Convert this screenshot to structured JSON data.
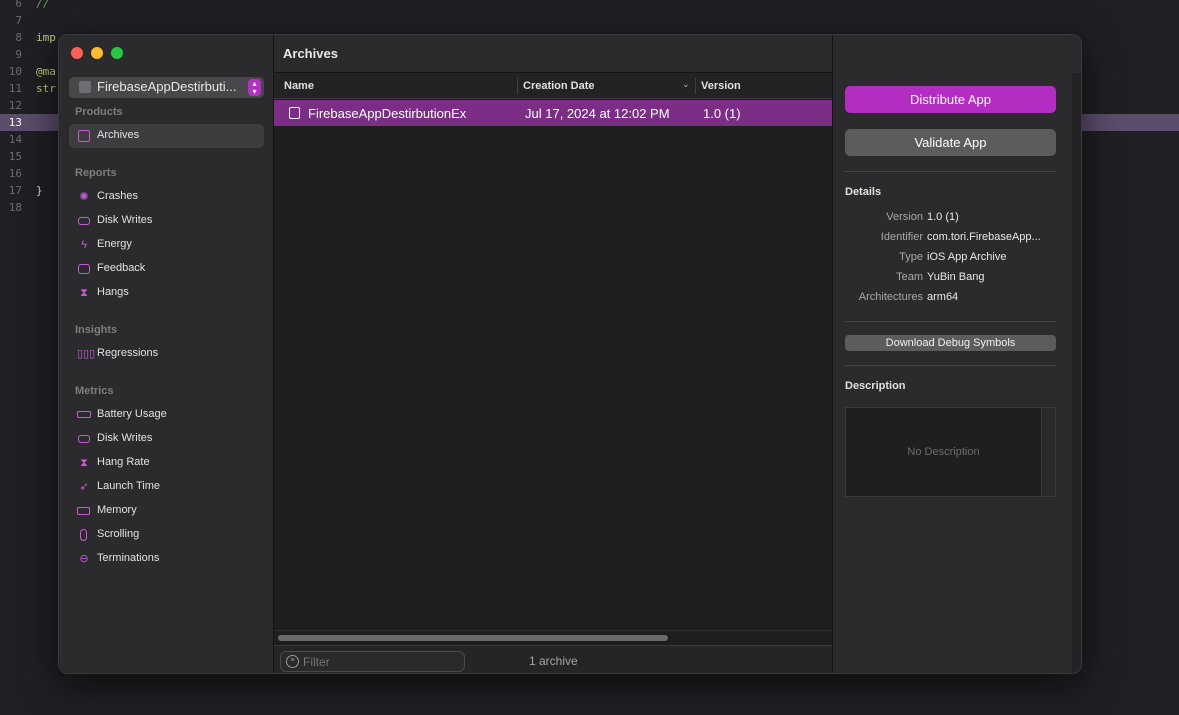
{
  "editor": {
    "lines": [
      {
        "num": "6",
        "text": "//",
        "kind": "comment"
      },
      {
        "num": "7",
        "text": "",
        "kind": "plain"
      },
      {
        "num": "8",
        "text": "imp",
        "kind": "kw"
      },
      {
        "num": "9",
        "text": "",
        "kind": "plain"
      },
      {
        "num": "10",
        "text": "@ma",
        "kind": "kw"
      },
      {
        "num": "11",
        "text": "str",
        "kind": "kw"
      },
      {
        "num": "12",
        "text": "",
        "kind": "plain"
      },
      {
        "num": "13",
        "text": "",
        "kind": "cur"
      },
      {
        "num": "14",
        "text": "",
        "kind": "plain"
      },
      {
        "num": "15",
        "text": "",
        "kind": "plain"
      },
      {
        "num": "16",
        "text": "",
        "kind": "plain"
      },
      {
        "num": "17",
        "text": "}",
        "kind": "plain"
      },
      {
        "num": "18",
        "text": "",
        "kind": "plain"
      }
    ]
  },
  "sidebar": {
    "app_selector": "FirebaseAppDestirbuti...",
    "sections": {
      "products": "Products",
      "reports": "Reports",
      "insights": "Insights",
      "metrics": "Metrics"
    },
    "products": [
      {
        "label": "Archives",
        "icon": "archive-icon"
      }
    ],
    "reports": [
      {
        "label": "Crashes",
        "icon": "crash-icon"
      },
      {
        "label": "Disk Writes",
        "icon": "disk-icon"
      },
      {
        "label": "Energy",
        "icon": "bolt-icon"
      },
      {
        "label": "Feedback",
        "icon": "speech-bubble-icon"
      },
      {
        "label": "Hangs",
        "icon": "hourglass-icon"
      }
    ],
    "insights": [
      {
        "label": "Regressions",
        "icon": "bar-chart-icon"
      }
    ],
    "metrics": [
      {
        "label": "Battery Usage",
        "icon": "battery-icon"
      },
      {
        "label": "Disk Writes",
        "icon": "disk-icon"
      },
      {
        "label": "Hang Rate",
        "icon": "hourglass-icon"
      },
      {
        "label": "Launch Time",
        "icon": "rocket-icon"
      },
      {
        "label": "Memory",
        "icon": "memory-icon"
      },
      {
        "label": "Scrolling",
        "icon": "scroll-icon"
      },
      {
        "label": "Terminations",
        "icon": "minus-circle-icon"
      }
    ]
  },
  "main": {
    "title": "Archives",
    "columns": {
      "name": "Name",
      "creation_date": "Creation Date",
      "version": "Version"
    },
    "rows": [
      {
        "name": "FirebaseAppDestirbutionEx",
        "date": "Jul 17, 2024 at 12:02 PM",
        "version": "1.0 (1)"
      }
    ],
    "filter_placeholder": "Filter",
    "archive_count": "1 archive"
  },
  "inspector": {
    "distribute_label": "Distribute App",
    "validate_label": "Validate App",
    "details_title": "Details",
    "details": [
      {
        "key": "Version",
        "value": "1.0 (1)"
      },
      {
        "key": "Identifier",
        "value": "com.tori.FirebaseApp..."
      },
      {
        "key": "Type",
        "value": "iOS App Archive"
      },
      {
        "key": "Team",
        "value": "YuBin Bang"
      },
      {
        "key": "Architectures",
        "value": "arm64"
      }
    ],
    "debug_symbols_label": "Download Debug Symbols",
    "description_title": "Description",
    "description_placeholder": "No Description"
  },
  "colors": {
    "accent": "#b42dc3",
    "selection": "#7c2e86"
  }
}
